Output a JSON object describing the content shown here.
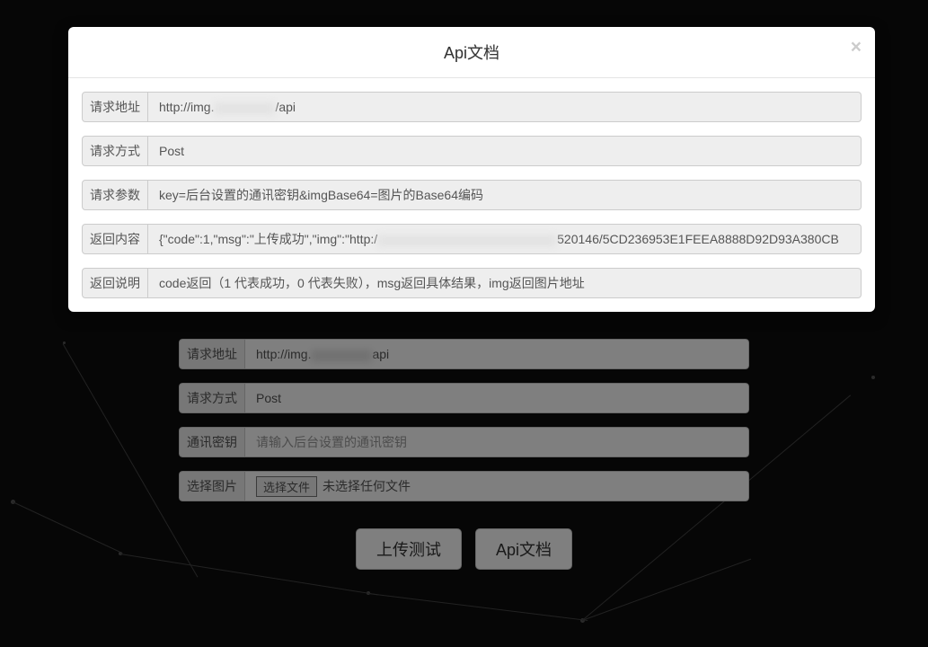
{
  "modal": {
    "title": "Api文档",
    "close": "×",
    "rows": [
      {
        "label": "请求地址",
        "parts": [
          "http://img.",
          "redacted",
          "/api"
        ]
      },
      {
        "label": "请求方式",
        "value": "Post"
      },
      {
        "label": "请求参数",
        "value": "key=后台设置的通讯密钥&imgBase64=图片的Base64编码"
      },
      {
        "label": "返回内容",
        "parts": [
          "{\"code\":1,\"msg\":\"上传成功\",\"img\":\"http:/",
          "redacted-long",
          "520146/5CD236953E1FEEA8888D92D93A380CB"
        ]
      },
      {
        "label": "返回说明",
        "value": "code返回（1 代表成功，0 代表失败），msg返回具体结果，img返回图片地址"
      }
    ]
  },
  "bgForm": {
    "rows": [
      {
        "label": "请求地址",
        "type": "readonly",
        "parts": [
          "http://img.",
          "redacted",
          "api"
        ]
      },
      {
        "label": "请求方式",
        "type": "readonly",
        "value": "Post"
      },
      {
        "label": "通讯密钥",
        "type": "input",
        "placeholder": "请输入后台设置的通讯密钥"
      },
      {
        "label": "选择图片",
        "type": "file",
        "button": "选择文件",
        "noFile": "未选择任何文件"
      }
    ],
    "buttons": {
      "upload": "上传测试",
      "apidoc": "Api文档"
    }
  }
}
